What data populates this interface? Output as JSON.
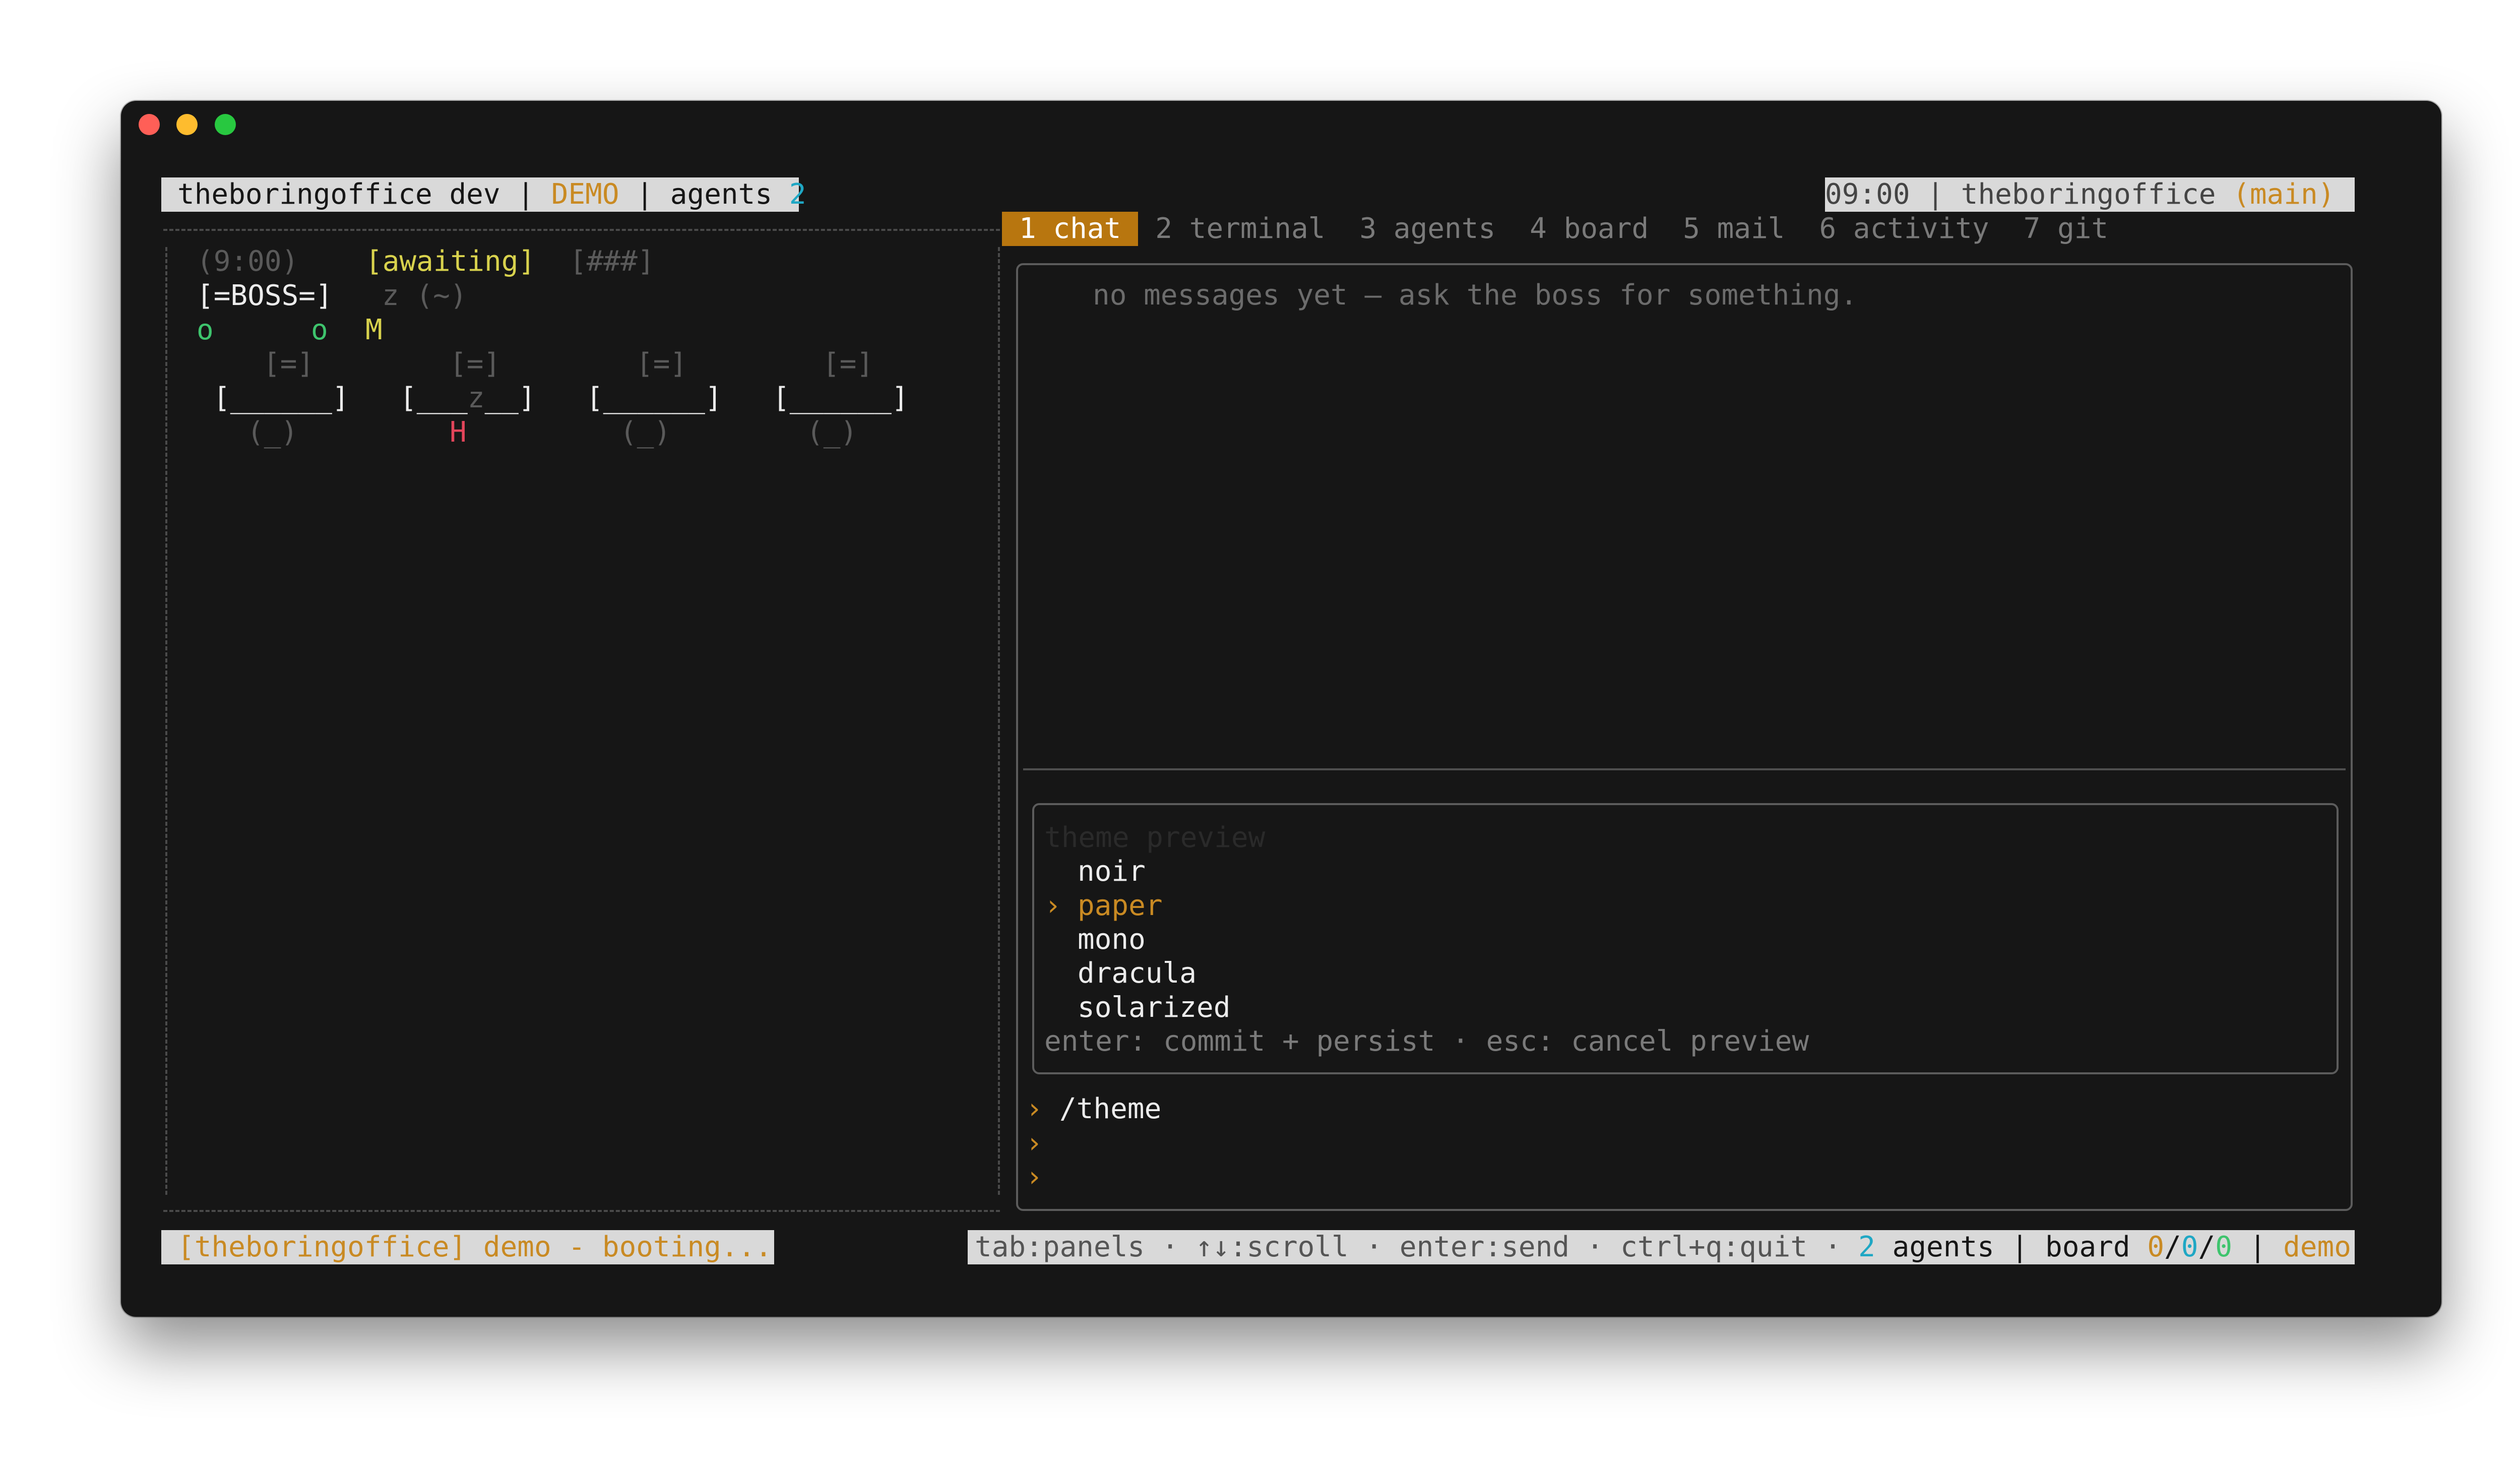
{
  "header_left": {
    "app": "theboringoffice dev",
    "sep1": " | ",
    "mode": "DEMO",
    "sep2": " | ",
    "agents_label": "agents ",
    "agents_count": "2"
  },
  "header_right": {
    "time": "09:00",
    "sep": " | ",
    "project": "theboringoffice",
    "branch": "(main)"
  },
  "tabs": [
    {
      "label": "1 chat"
    },
    {
      "label": "2 terminal"
    },
    {
      "label": "3 agents"
    },
    {
      "label": "4 board"
    },
    {
      "label": "5 mail"
    },
    {
      "label": "6 activity"
    },
    {
      "label": "7 git"
    }
  ],
  "office": {
    "clock": "(9:00)",
    "status": "[awaiting]",
    "progress": "[###]",
    "boss": "[=BOSS=]",
    "boss_sleep": "z (~)",
    "agent_o1": "o",
    "agent_o2": "o",
    "agent_m": "M",
    "monitor": "[=]",
    "desk": "[______]",
    "desk_sleep_left": "[___",
    "desk_sleep_z": "z",
    "desk_sleep_right": "__]",
    "chair": "(_)",
    "agent_h": "H"
  },
  "chat": {
    "empty_message": "no messages yet — ask the boss for something."
  },
  "theme_preview": {
    "title": "theme preview",
    "options": [
      "noir",
      "paper",
      "mono",
      "dracula",
      "solarized"
    ],
    "selected_index": 1,
    "selected_marker": "›",
    "hint": "enter: commit + persist · esc: cancel preview"
  },
  "prompt": {
    "marker": "›",
    "command": "/theme"
  },
  "footer_left": {
    "text": "[theboringoffice] demo - booting..."
  },
  "footer_right": {
    "keys": "tab:panels · ↑↓:scroll · enter:send · ctrl+q:quit · ",
    "agents_count": "2",
    "agents_label": " agents | board ",
    "board_a": "0",
    "slash1": "/",
    "board_b": "0",
    "slash2": "/",
    "board_c": "0",
    "sep": " | ",
    "mode": "demo"
  },
  "colors": {
    "background": "#161616",
    "accent": "#c98a23",
    "active_tab": "#b8760f",
    "cyan": "#1fa7c4",
    "green": "#3ec46d",
    "red": "#e2455a",
    "yellow": "#d8d24d"
  }
}
